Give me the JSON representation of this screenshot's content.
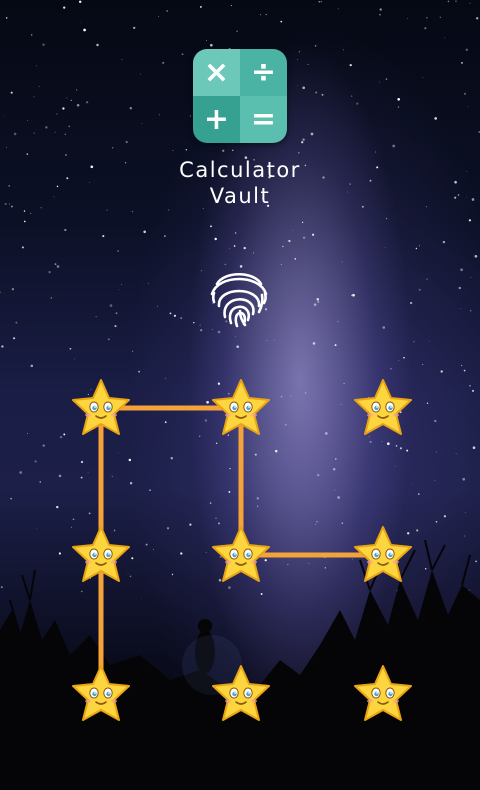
{
  "app": {
    "name_line1": "Calculator",
    "name_line2": "Vault",
    "logo_symbols": [
      "×",
      "÷",
      "+",
      "="
    ],
    "logo_colors": [
      "#6cc9b9",
      "#4ab3a3",
      "#36a091",
      "#5bbfb0"
    ]
  },
  "fingerprint": {
    "icon": "fingerprint-icon"
  },
  "pattern": {
    "dot_icon": "smiling-star-icon",
    "rows": 3,
    "cols": 3,
    "drawn_sequence": [
      6,
      3,
      0,
      1,
      4,
      5
    ],
    "line_color": "#f4a23a"
  },
  "colors": {
    "star_fill": "#fcd53f",
    "star_stroke": "#e9a313",
    "sky_top": "#050914",
    "sky_mid": "#1c1f48"
  }
}
